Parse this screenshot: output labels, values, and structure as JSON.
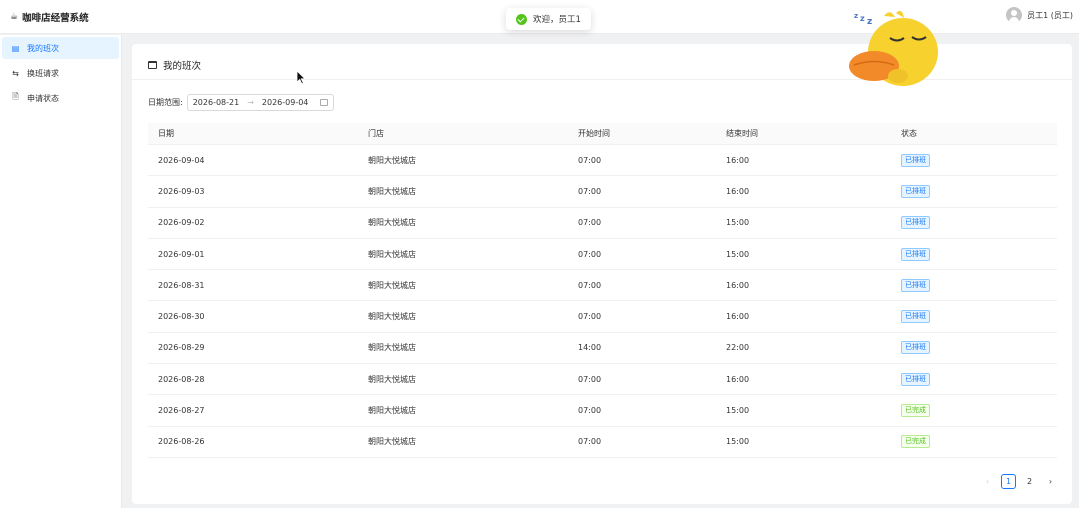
{
  "header": {
    "brand_icon": "coffee-icon",
    "brand": "咖啡店经营系统",
    "user": "员工1 (员工)"
  },
  "toast": {
    "message": "欢迎，员工1"
  },
  "sidebar": {
    "items": [
      {
        "label": "我的班次",
        "icon": "calendar-icon",
        "active": true
      },
      {
        "label": "换班请求",
        "icon": "swap-icon",
        "active": false
      },
      {
        "label": "申请状态",
        "icon": "file-icon",
        "active": false
      }
    ]
  },
  "main": {
    "title": "我的班次",
    "filter": {
      "label": "日期范围:",
      "start": "2026-08-21",
      "separator": "→",
      "end": "2026-09-04"
    },
    "table": {
      "columns": [
        "日期",
        "门店",
        "开始时间",
        "结束时间",
        "状态"
      ],
      "rows": [
        {
          "date": "2026-09-04",
          "store": "朝阳大悦城店",
          "start": "07:00",
          "end": "16:00",
          "status": "已排班",
          "tone": "blue"
        },
        {
          "date": "2026-09-03",
          "store": "朝阳大悦城店",
          "start": "07:00",
          "end": "16:00",
          "status": "已排班",
          "tone": "blue"
        },
        {
          "date": "2026-09-02",
          "store": "朝阳大悦城店",
          "start": "07:00",
          "end": "15:00",
          "status": "已排班",
          "tone": "blue"
        },
        {
          "date": "2026-09-01",
          "store": "朝阳大悦城店",
          "start": "07:00",
          "end": "15:00",
          "status": "已排班",
          "tone": "blue"
        },
        {
          "date": "2026-08-31",
          "store": "朝阳大悦城店",
          "start": "07:00",
          "end": "16:00",
          "status": "已排班",
          "tone": "blue"
        },
        {
          "date": "2026-08-30",
          "store": "朝阳大悦城店",
          "start": "07:00",
          "end": "16:00",
          "status": "已排班",
          "tone": "blue"
        },
        {
          "date": "2026-08-29",
          "store": "朝阳大悦城店",
          "start": "14:00",
          "end": "22:00",
          "status": "已排班",
          "tone": "blue"
        },
        {
          "date": "2026-08-28",
          "store": "朝阳大悦城店",
          "start": "07:00",
          "end": "16:00",
          "status": "已排班",
          "tone": "blue"
        },
        {
          "date": "2026-08-27",
          "store": "朝阳大悦城店",
          "start": "07:00",
          "end": "15:00",
          "status": "已完成",
          "tone": "green"
        },
        {
          "date": "2026-08-26",
          "store": "朝阳大悦城店",
          "start": "07:00",
          "end": "15:00",
          "status": "已完成",
          "tone": "green"
        }
      ]
    },
    "pagination": {
      "prev": "‹",
      "pages": [
        "1",
        "2"
      ],
      "current": "1",
      "next": "›"
    }
  },
  "colors": {
    "primary": "#1677ff",
    "success": "#52c41a",
    "active_bg": "#e6f4ff"
  }
}
